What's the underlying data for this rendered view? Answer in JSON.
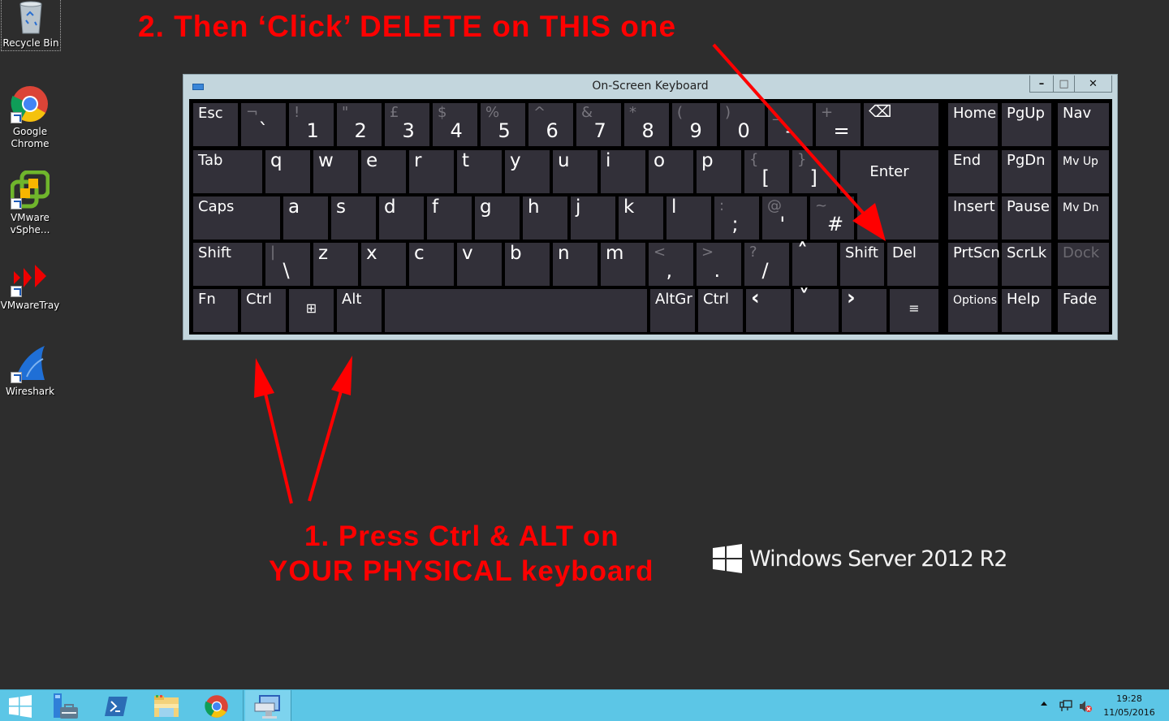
{
  "desktop": {
    "icons": [
      {
        "label": "Recycle Bin",
        "icon": "recycle-bin-icon"
      },
      {
        "label_line1": "Google",
        "label_line2": "Chrome",
        "icon": "chrome-icon"
      },
      {
        "label_line1": "VMware",
        "label_line2": "vSphe...",
        "icon": "vsphere-icon"
      },
      {
        "label": "VMwareTray",
        "icon": "vmware-tray-icon"
      },
      {
        "label": "Wireshark",
        "icon": "wireshark-icon"
      }
    ],
    "background_color": "#2d2d2d"
  },
  "annotations": {
    "step2": "2. Then ‘Click’ DELETE on THIS one",
    "step1_line1": "1. Press Ctrl & ALT on",
    "step1_line2": "YOUR PHYSICAL keyboard",
    "color": "#ff0000"
  },
  "branding": {
    "text": "Windows Server 2012 R2"
  },
  "osk": {
    "title": "On-Screen Keyboard",
    "window_buttons": {
      "minimize": "–",
      "maximize": "□",
      "close": "✕"
    },
    "rows": {
      "row1": [
        {
          "label": "Esc"
        },
        {
          "upper": "¬",
          "lower": "`"
        },
        {
          "upper": "!",
          "lower": "1"
        },
        {
          "upper": "\"",
          "lower": "2"
        },
        {
          "upper": "£",
          "lower": "3"
        },
        {
          "upper": "$",
          "lower": "4"
        },
        {
          "upper": "%",
          "lower": "5"
        },
        {
          "upper": "^",
          "lower": "6"
        },
        {
          "upper": "&",
          "lower": "7"
        },
        {
          "upper": "*",
          "lower": "8"
        },
        {
          "upper": "(",
          "lower": "9"
        },
        {
          "upper": ")",
          "lower": "0"
        },
        {
          "upper": "_",
          "lower": "-"
        },
        {
          "upper": "+",
          "lower": "="
        },
        {
          "label": "⌫",
          "name": "backspace"
        }
      ],
      "row2": [
        {
          "label": "Tab"
        },
        {
          "letter": "q"
        },
        {
          "letter": "w"
        },
        {
          "letter": "e"
        },
        {
          "letter": "r"
        },
        {
          "letter": "t"
        },
        {
          "letter": "y"
        },
        {
          "letter": "u"
        },
        {
          "letter": "i"
        },
        {
          "letter": "o"
        },
        {
          "letter": "p"
        },
        {
          "upper": "{",
          "lower": "["
        },
        {
          "upper": "}",
          "lower": "]"
        },
        {
          "label": "Enter"
        }
      ],
      "row3": [
        {
          "label": "Caps"
        },
        {
          "letter": "a"
        },
        {
          "letter": "s"
        },
        {
          "letter": "d"
        },
        {
          "letter": "f"
        },
        {
          "letter": "g"
        },
        {
          "letter": "h"
        },
        {
          "letter": "j"
        },
        {
          "letter": "k"
        },
        {
          "letter": "l"
        },
        {
          "upper": ":",
          "lower": ";"
        },
        {
          "upper": "@",
          "lower": "'"
        },
        {
          "upper": "~",
          "lower": "#"
        }
      ],
      "row4": [
        {
          "label": "Shift"
        },
        {
          "upper": "|",
          "lower": "\\"
        },
        {
          "letter": "z"
        },
        {
          "letter": "x"
        },
        {
          "letter": "c"
        },
        {
          "letter": "v"
        },
        {
          "letter": "b"
        },
        {
          "letter": "n"
        },
        {
          "letter": "m"
        },
        {
          "upper": "<",
          "lower": ","
        },
        {
          "upper": ">",
          "lower": "."
        },
        {
          "upper": "?",
          "lower": "/"
        },
        {
          "label": "˄",
          "name": "up-arrow"
        },
        {
          "label": "Shift"
        },
        {
          "label": "Del"
        }
      ],
      "row5": [
        {
          "label": "Fn"
        },
        {
          "label": "Ctrl"
        },
        {
          "label": "⊞",
          "name": "windows"
        },
        {
          "label": "Alt"
        },
        {
          "label": "",
          "name": "space"
        },
        {
          "label": "AltGr"
        },
        {
          "label": "Ctrl"
        },
        {
          "label": "‹",
          "name": "left-arrow"
        },
        {
          "label": "˅",
          "name": "down-arrow"
        },
        {
          "label": "›",
          "name": "right-arrow"
        },
        {
          "label": "≡",
          "name": "menu"
        }
      ]
    },
    "nav_keys": [
      [
        "Home",
        "PgUp",
        "Nav"
      ],
      [
        "End",
        "PgDn",
        "Mv Up"
      ],
      [
        "Insert",
        "Pause",
        "Mv Dn"
      ],
      [
        "PrtScn",
        "ScrLk",
        "Dock"
      ],
      [
        "Options",
        "Help",
        "Fade"
      ]
    ]
  },
  "taskbar": {
    "pinned": [
      "start-button",
      "server-manager-icon",
      "powershell-icon",
      "file-explorer-icon",
      "chrome-icon",
      "on-screen-keyboard-icon"
    ],
    "tray": {
      "time": "19:28",
      "date": "11/05/2016"
    },
    "color": "#5cc6e6"
  }
}
